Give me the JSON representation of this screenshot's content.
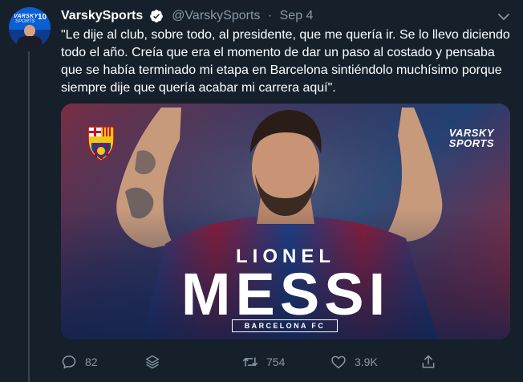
{
  "tweet": {
    "display_name": "VarskySports",
    "handle": "@VarskySports",
    "separator": "·",
    "date": "Sep 4",
    "text": "\"Le dije al club, sobre todo, al presidente, que me quería ir. Se lo llevo diciendo todo el año. Creía que era el momento de dar un paso al costado y pensaba que se había terminado mi etapa en Barcelona sintiéndolo muchísimo porque siempre dije que quería acabar mi carrera aquí\".",
    "avatar": {
      "brand_top": "VARSKY",
      "brand_bottom": "SPORTS",
      "anniversary": "10"
    }
  },
  "media": {
    "first_name": "LIONEL",
    "last_name": "MESSI",
    "club": "BARCELONA FC",
    "logo_line1": "VARSKY",
    "logo_line2": "SPORTS",
    "crest_letters": "FCB"
  },
  "actions": {
    "reply_count": "82",
    "retweet_count": "754",
    "like_count": "3.9K"
  },
  "icons": {
    "verified": "verified-badge-icon",
    "menu": "chevron-down-icon",
    "reply": "reply-icon",
    "stack": "layers-icon",
    "retweet": "retweet-icon",
    "like": "heart-icon",
    "share": "share-icon"
  },
  "colors": {
    "background": "#15202b",
    "secondary_text": "#8899a6",
    "divider": "#38444d",
    "barca_blue": "#1f3f73",
    "barca_red": "#b8222f"
  }
}
